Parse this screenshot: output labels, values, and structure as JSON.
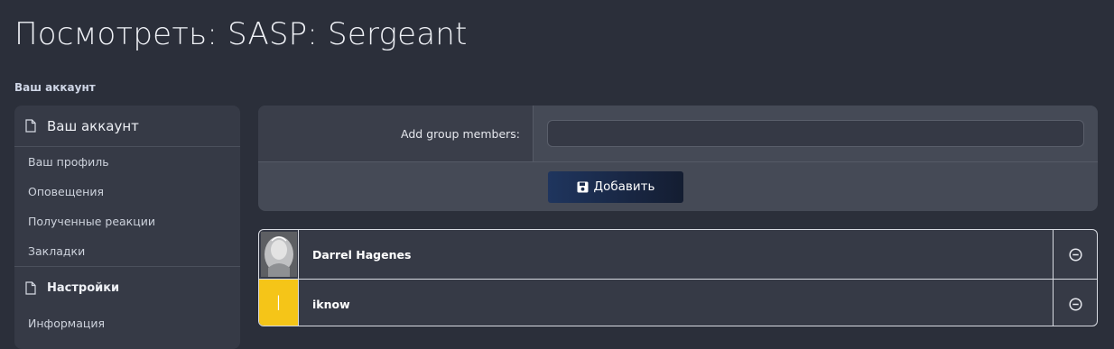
{
  "page": {
    "title": "Посмотреть: SASP: Sergeant"
  },
  "sidebar": {
    "section_label": "Ваш аккаунт",
    "header": "Ваш аккаунт",
    "items": [
      {
        "label": "Ваш профиль"
      },
      {
        "label": "Оповещения"
      },
      {
        "label": "Полученные реакции"
      },
      {
        "label": "Закладки"
      }
    ],
    "settings_header": "Настройки",
    "settings_items": [
      {
        "label": "Информация"
      }
    ]
  },
  "form": {
    "add_members_label": "Add group members:",
    "add_members_value": "",
    "add_button_label": "Добавить"
  },
  "members": [
    {
      "name": "Darrel Hagenes",
      "avatar": "photo"
    },
    {
      "name": "iknow",
      "avatar": "I",
      "avatar_color": "#f5c518"
    }
  ],
  "colors": {
    "background": "#2b2f3a",
    "panel": "#454a56",
    "button": "#1f355e",
    "avatar_yellow": "#f5c518"
  }
}
